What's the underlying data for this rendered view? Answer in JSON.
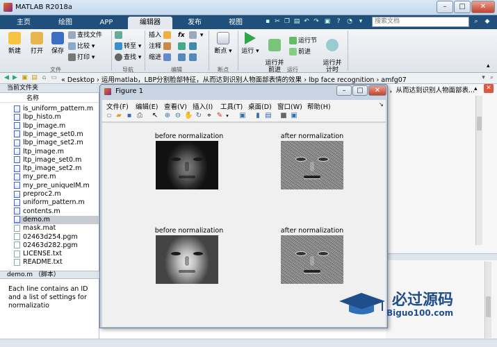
{
  "app": {
    "title": "MATLAB R2018a"
  },
  "window_controls": {
    "minimize": "–",
    "maximize": "□",
    "close": "✕"
  },
  "tabs": [
    {
      "label": "主页"
    },
    {
      "label": "绘图"
    },
    {
      "label": "APP"
    },
    {
      "label": "编辑器",
      "active": true
    },
    {
      "label": "发布"
    },
    {
      "label": "视图"
    }
  ],
  "search": {
    "placeholder": "搜索文档"
  },
  "ribbon": {
    "file": {
      "new": "新建",
      "open": "打开",
      "save": "保存",
      "find_files": "查找文件",
      "compare": "比较",
      "print": "打印",
      "group": "文件"
    },
    "navigate": {
      "goto": "转至",
      "find": "查找",
      "group": "导航"
    },
    "edit": {
      "insert": "插入",
      "comment": "注释",
      "indent": "缩进",
      "fx": "fx",
      "group": "编辑"
    },
    "breakpoints": {
      "breakpoints": "断点",
      "group": "断点"
    },
    "run": {
      "run": "运行",
      "run_advance": "运行并\n前进",
      "run_section": "运行节",
      "advance": "前进",
      "run_time": "运行并\n计时",
      "group": "运行"
    }
  },
  "address": {
    "path": "« Desktop › 运用matlab，LBP分割脸部特征，从而达到识别人物面部表情的效果 › lbp face recognition › amfg07"
  },
  "current_folder": {
    "title": "当前文件夹",
    "column": "名称",
    "files": [
      {
        "name": "is_uniform_pattern.m",
        "type": "m"
      },
      {
        "name": "lbp_histo.m",
        "type": "m"
      },
      {
        "name": "lbp_image.m",
        "type": "m"
      },
      {
        "name": "lbp_image_set0.m",
        "type": "m"
      },
      {
        "name": "lbp_image_set2.m",
        "type": "m"
      },
      {
        "name": "ltp_image.m",
        "type": "m"
      },
      {
        "name": "ltp_image_set0.m",
        "type": "m"
      },
      {
        "name": "ltp_image_set2.m",
        "type": "m"
      },
      {
        "name": "my_pre.m",
        "type": "m"
      },
      {
        "name": "my_pre_uniqueIM.m",
        "type": "m"
      },
      {
        "name": "preproc2.m",
        "type": "m"
      },
      {
        "name": "uniform_pattern.m",
        "type": "m"
      },
      {
        "name": "contents.m",
        "type": "m"
      },
      {
        "name": "demo.m",
        "type": "m",
        "selected": true
      },
      {
        "name": "mask.mat",
        "type": "other"
      },
      {
        "name": "02463d254.pgm",
        "type": "other"
      },
      {
        "name": "02463d282.pgm",
        "type": "other"
      },
      {
        "name": "LICENSE.txt",
        "type": "other"
      },
      {
        "name": "README.txt",
        "type": "other"
      }
    ],
    "detail_title": "demo.m （脚本）",
    "detail_text": "Each line contains an ID and a list of settings for normalizatio"
  },
  "editor": {
    "title_fragment": "，从而达到识别人物面部表..."
  },
  "figure": {
    "title": "Figure 1",
    "menu": [
      "文件(F)",
      "编辑(E)",
      "查看(V)",
      "插入(I)",
      "工具(T)",
      "桌面(D)",
      "窗口(W)",
      "帮助(H)"
    ],
    "subplots": [
      {
        "label": "before normalization"
      },
      {
        "label": "after normalization"
      },
      {
        "label": "before normalization"
      },
      {
        "label": "after normalization"
      }
    ]
  },
  "watermark": {
    "brand": "必过源码",
    "url": "Biguo100.com"
  },
  "colors": {
    "tabbar": "#1f4f7a",
    "brand": "#1f4f8a"
  }
}
